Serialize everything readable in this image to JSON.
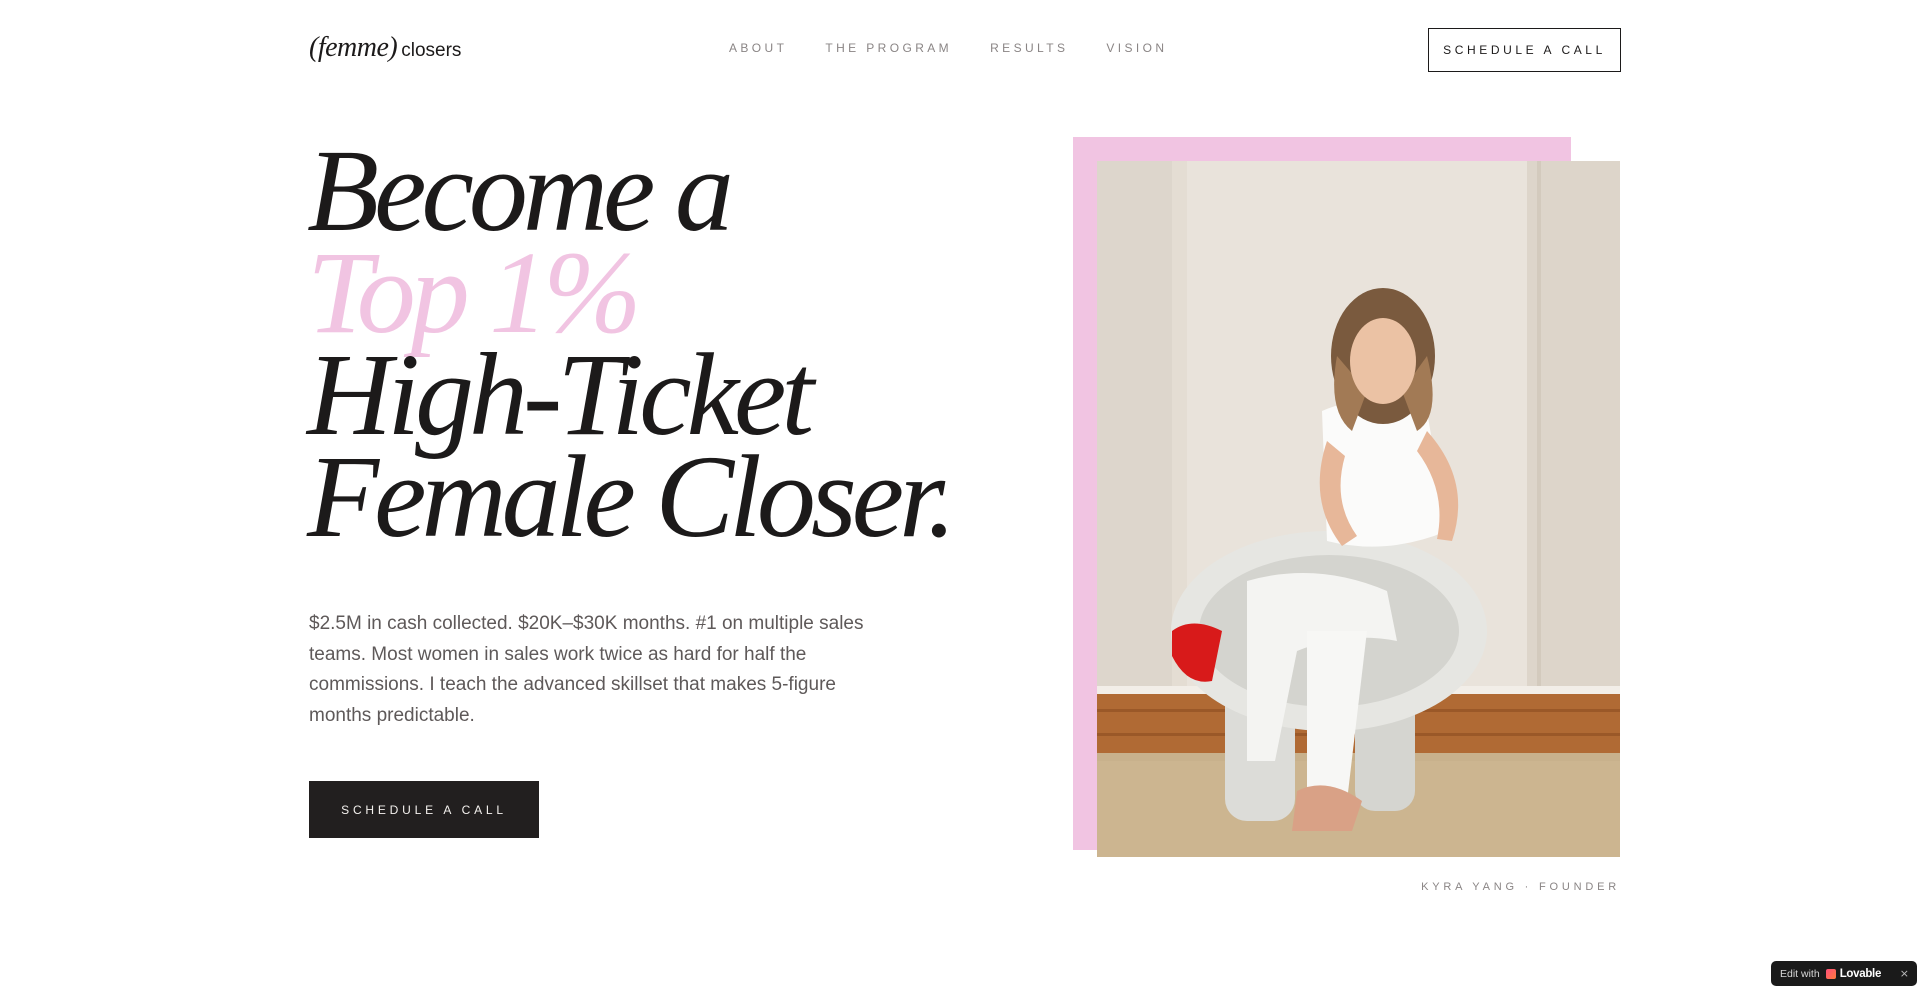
{
  "brand": {
    "logo_italic": "(femme)",
    "logo_plain": "closers"
  },
  "nav": {
    "items": [
      "ABOUT",
      "THE PROGRAM",
      "RESULTS",
      "VISION"
    ],
    "cta_label": "SCHEDULE A CALL"
  },
  "hero": {
    "title_lines": [
      "Become a",
      "Top 1%",
      "High-Ticket",
      "Female Closer."
    ],
    "description": "$2.5M in cash collected. $20K–$30K months. #1 on multiple sales teams. Most women in sales work twice as hard for half the commissions. I teach the advanced skillset that makes 5-figure months predictable.",
    "cta_label": "SCHEDULE A CALL"
  },
  "photo": {
    "caption": "KYRA YANG · FOUNDER"
  },
  "badge": {
    "prefix": "Edit with",
    "brand": "Lovable",
    "close": "×"
  },
  "colors": {
    "accent_pink": "#f1c4e2",
    "ink": "#1c1a1a",
    "button_dark": "#221f1f",
    "muted_text": "#5e5959",
    "nav_text": "#8a8585"
  }
}
